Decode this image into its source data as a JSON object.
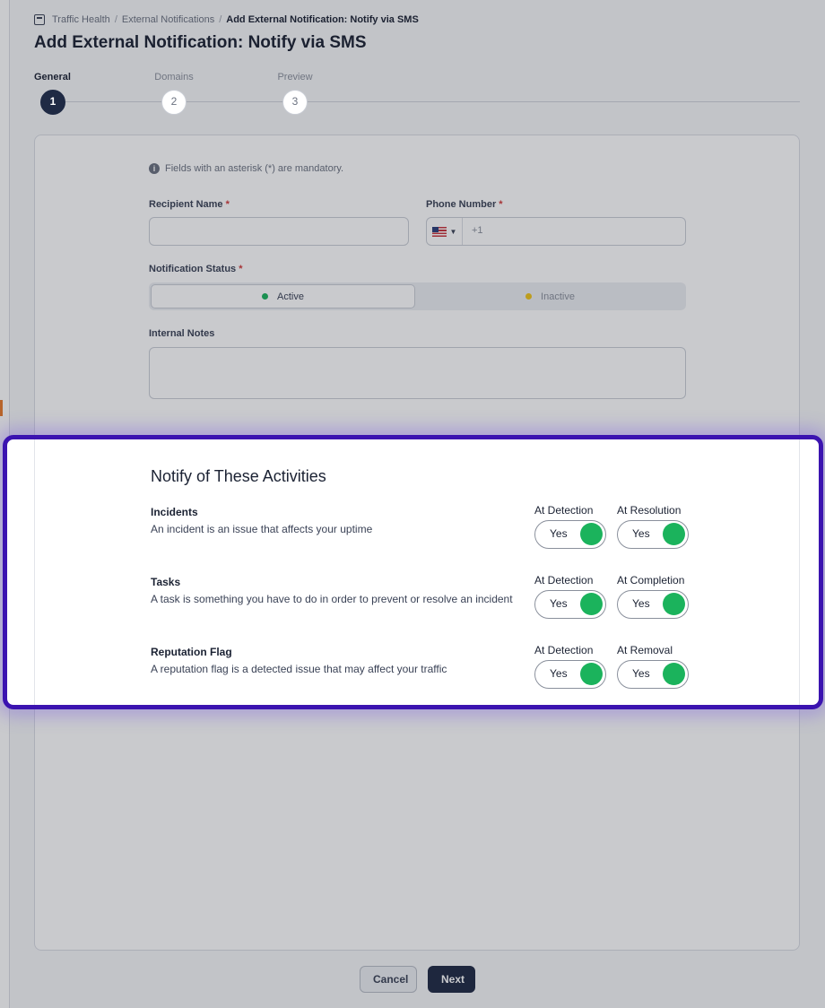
{
  "breadcrumb": {
    "items": [
      "Traffic Health",
      "External Notifications",
      "Add External Notification: Notify via SMS"
    ],
    "separator": "/"
  },
  "page_title": "Add External Notification: Notify via SMS",
  "steps": [
    {
      "label": "General",
      "number": "1",
      "active": true
    },
    {
      "label": "Domains",
      "number": "2",
      "active": false
    },
    {
      "label": "Preview",
      "number": "3",
      "active": false
    }
  ],
  "form": {
    "hint": "Fields with an asterisk (*) are mandatory.",
    "required_marker": "*",
    "recipient_name": {
      "label": "Recipient Name",
      "value": ""
    },
    "phone_number": {
      "label": "Phone Number",
      "country": "US",
      "value": "+1"
    },
    "notification_status": {
      "label": "Notification Status",
      "options": [
        "Active",
        "Inactive"
      ],
      "selected": "Active"
    },
    "internal_notes": {
      "label": "Internal Notes",
      "value": ""
    }
  },
  "activities": {
    "title": "Notify of These Activities",
    "items": [
      {
        "name": "Incidents",
        "description": "An incident is an issue that affects your uptime",
        "toggles": [
          {
            "label": "At Detection",
            "value": "Yes"
          },
          {
            "label": "At Resolution",
            "value": "Yes"
          }
        ]
      },
      {
        "name": "Tasks",
        "description": "A task is something you have to do in order to prevent or resolve an incident",
        "toggles": [
          {
            "label": "At Detection",
            "value": "Yes"
          },
          {
            "label": "At Completion",
            "value": "Yes"
          }
        ]
      },
      {
        "name": "Reputation Flag",
        "description": "A reputation flag is a detected issue that may affect your traffic",
        "toggles": [
          {
            "label": "At Detection",
            "value": "Yes"
          },
          {
            "label": "At Removal",
            "value": "Yes"
          }
        ]
      }
    ]
  },
  "buttons": {
    "cancel": "Cancel",
    "next": "Next"
  },
  "colors": {
    "highlight_border": "#3b13b0",
    "toggle_on": "#1bb35c",
    "primary": "#1f2a44",
    "status_active": "#1bb35c",
    "status_inactive": "#f0c419"
  }
}
